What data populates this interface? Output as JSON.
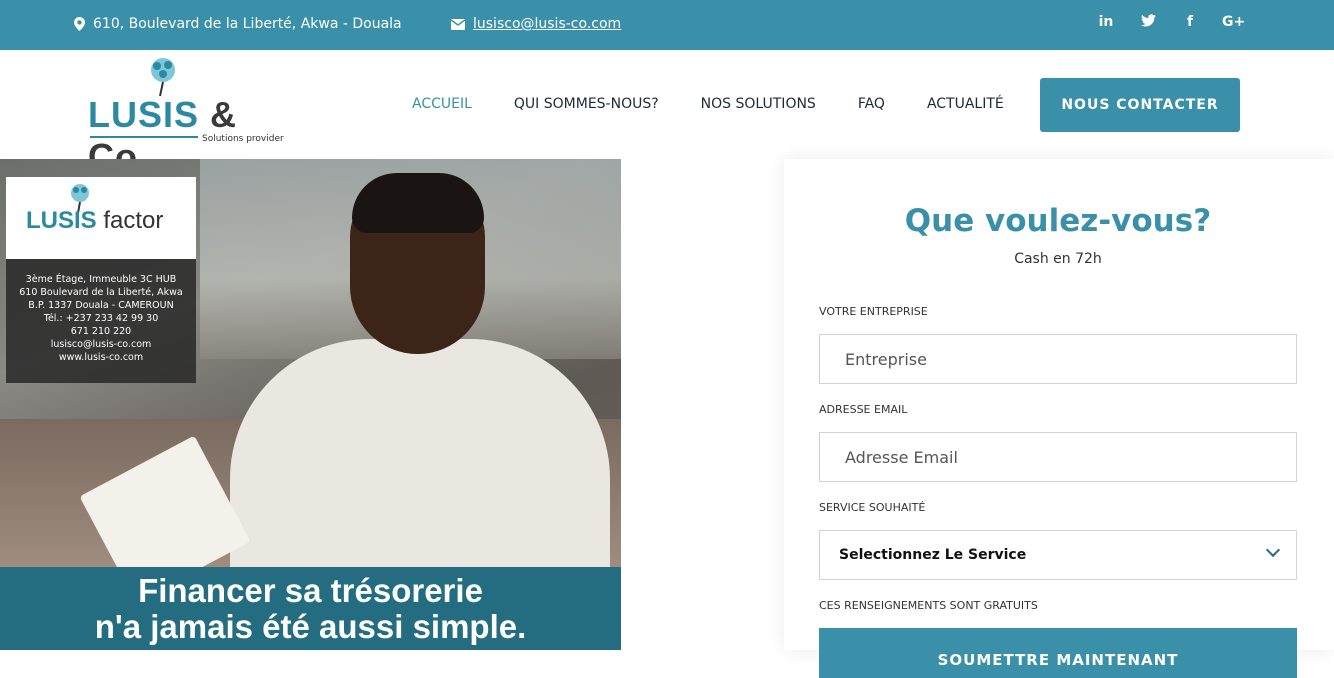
{
  "topbar": {
    "address": "610, Boulevard de la Liberté, Akwa - Douala",
    "email": "lusisco@lusis-co.com",
    "social": [
      "in",
      "t",
      "f",
      "G+"
    ]
  },
  "header": {
    "logo_main": "LUSIS",
    "logo_amp": "& Co",
    "logo_sub": "Solutions provider",
    "nav": [
      {
        "label": "ACCUEIL"
      },
      {
        "label": "QUI SOMMES-NOUS?"
      },
      {
        "label": "NOS SOLUTIONS"
      },
      {
        "label": "FAQ"
      },
      {
        "label": "ACTUALITÉ"
      }
    ],
    "cta": "NOUS CONTACTER"
  },
  "hero": {
    "card_title_a": "LUSIS",
    "card_title_b": "factor",
    "card_lines": [
      "3ème Étage, Immeuble 3C HUB",
      "610 Boulevard de la Liberté, Akwa",
      "B.P. 1337 Douala  -  CAMEROUN",
      "Tél.: +237 233 42 99 30",
      "671 210 220",
      "lusisco@lusis-co.com",
      "www.lusis-co.com"
    ],
    "banner_line1": "Financer sa trésorerie",
    "banner_line2": "n'a jamais été aussi simple."
  },
  "form": {
    "title": "Que voulez-vous?",
    "subtitle": "Cash en 72h",
    "company_label": "VOTRE ENTREPRISE",
    "company_placeholder": "Entreprise",
    "email_label": "ADRESSE EMAIL",
    "email_placeholder": "Adresse Email",
    "service_label": "SERVICE SOUHAITÉ",
    "service_selected": "Selectionnez Le Service",
    "note": "CES RENSEIGNEMENTS SONT GRATUITS",
    "submit": "SOUMETTRE MAINTENANT"
  },
  "colors": {
    "accent": "#3a90a8",
    "dark_banner": "#246d80"
  }
}
